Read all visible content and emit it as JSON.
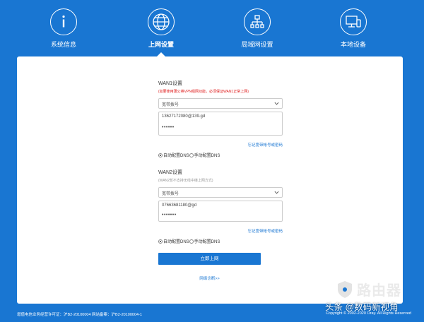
{
  "nav": {
    "items": [
      {
        "label": "系统信息",
        "icon": "info-icon"
      },
      {
        "label": "上网设置",
        "icon": "globe-icon"
      },
      {
        "label": "局域网设置",
        "icon": "network-icon"
      },
      {
        "label": "本地设备",
        "icon": "devices-icon"
      }
    ],
    "active_index": 1
  },
  "wan1": {
    "title": "WAN1设置",
    "note": "(如要使用蒲公英VPN组网功能，必须保证WAN1正常上网)",
    "mode": "宽带拨号",
    "account": "13627172080@139.gd",
    "password_mask": "••••••",
    "forgot_label": "忘记宽带帐号或密码",
    "dns_auto": "自动配置DNS",
    "dns_manual": "手动配置DNS"
  },
  "wan2": {
    "title": "WAN2设置",
    "note": "(WAN2暂不支持无线中继上网方式)",
    "mode": "宽带拨号",
    "account": "07663681180@gd",
    "password_mask": "•••••••",
    "forgot_label": "忘记宽带帐号或密码",
    "dns_auto": "自动配置DNS",
    "dns_manual": "手动配置DNS"
  },
  "actions": {
    "connect_label": "立即上网",
    "diagnose_label": "网络诊断>>"
  },
  "footer": {
    "left": "增值电信业务经营许可证：沪B2-20100004 网站备案：沪B2-20100004-1",
    "right": "Copyright © 2002-2020 Oray. All Rights Reserved"
  },
  "watermark": {
    "logo_text": "路由器",
    "author": "头条 @数码新视角"
  },
  "colors": {
    "primary": "#1976d2",
    "note_red": "#e02020",
    "link": "#1976d2"
  }
}
